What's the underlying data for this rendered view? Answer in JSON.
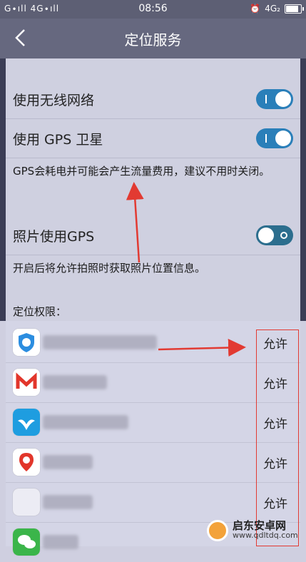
{
  "status_bar": {
    "left": "G∙ıll 4G∙ıll",
    "time": "08:56",
    "network": "4G₂"
  },
  "header": {
    "title": "定位服务"
  },
  "settings": {
    "wifi_label": "使用无线网络",
    "gps_label": "使用 GPS 卫星",
    "gps_note": "GPS会耗电并可能会产生流量费用，建议不用时关闭。",
    "photo_label": "照片使用GPS",
    "photo_note": "开启后将允许拍照时获取照片位置信息。",
    "perm_title": "定位权限："
  },
  "apps": [
    {
      "allow": "允许",
      "icon": "qq-security-icon"
    },
    {
      "allow": "允许",
      "icon": "gmail-icon"
    },
    {
      "allow": "允许",
      "icon": "bird-app-icon"
    },
    {
      "allow": "允许",
      "icon": "baidu-map-icon"
    },
    {
      "allow": "允许",
      "icon": "blurred-app-icon"
    }
  ],
  "colors": {
    "accent": "#2a7fb9",
    "annotation": "#e23a32"
  },
  "watermark": {
    "line1": "启东安卓网",
    "line2": "www.qdltdq.com"
  }
}
